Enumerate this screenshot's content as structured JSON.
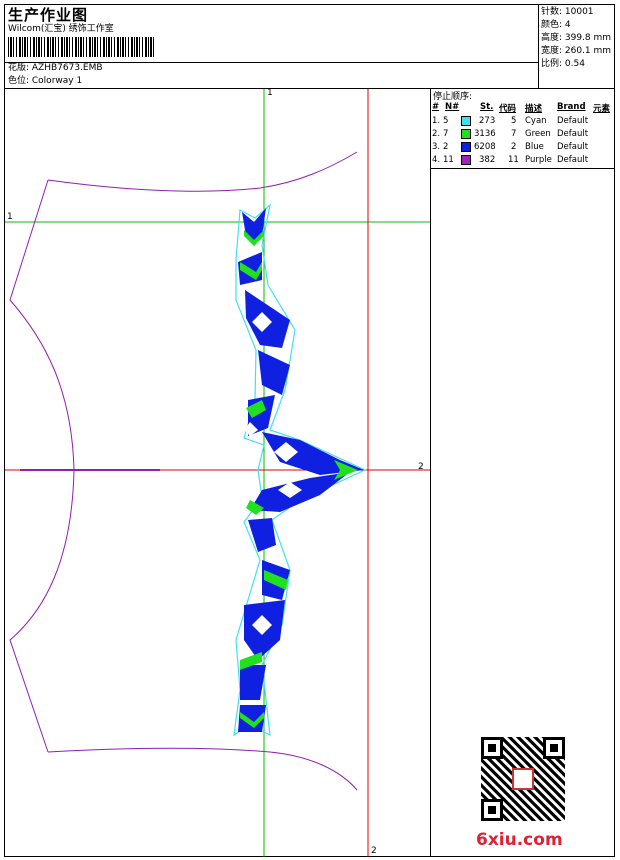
{
  "header": {
    "title": "生产作业图",
    "company": "Wilcom(汇宝) 绣饰工作室",
    "design_label": "花版: AZHB7673.EMB",
    "colorway_label": "色位: Colorway 1"
  },
  "stats": {
    "stitches": "针数: 10001",
    "colors": "颜色: 4",
    "height": "高度: 399.8 mm",
    "width": "宽度: 260.1 mm",
    "scale": "比例: 0.54"
  },
  "legend": {
    "title": "停止顺序:",
    "headers": [
      "#",
      "N#",
      "St.",
      "代码",
      "描述",
      "Brand",
      "元素"
    ],
    "rows": [
      {
        "idx": "1.",
        "n": "5",
        "st": "273",
        "code": "5",
        "desc": "Cyan",
        "brand": "Default",
        "color": "#40e0f0"
      },
      {
        "idx": "2.",
        "n": "7",
        "st": "3136",
        "code": "7",
        "desc": "Green",
        "brand": "Default",
        "color": "#20e020"
      },
      {
        "idx": "3.",
        "n": "2",
        "st": "6208",
        "code": "2",
        "desc": "Blue",
        "brand": "Default",
        "color": "#1020e0"
      },
      {
        "idx": "4.",
        "n": "11",
        "st": "382",
        "code": "11",
        "desc": "Purple",
        "brand": "Default",
        "color": "#a020c0"
      }
    ]
  },
  "axes": {
    "label_v1": "1",
    "label_h1": "1",
    "label_h2": "2",
    "label_v2": "2"
  },
  "colors": {
    "green_guide": "#00c000",
    "red_guide": "#e00000",
    "outline": "#9020b0",
    "cyan": "#40e0f0",
    "blue": "#1020e0",
    "green": "#20e020"
  },
  "watermark": "6xiu.com"
}
